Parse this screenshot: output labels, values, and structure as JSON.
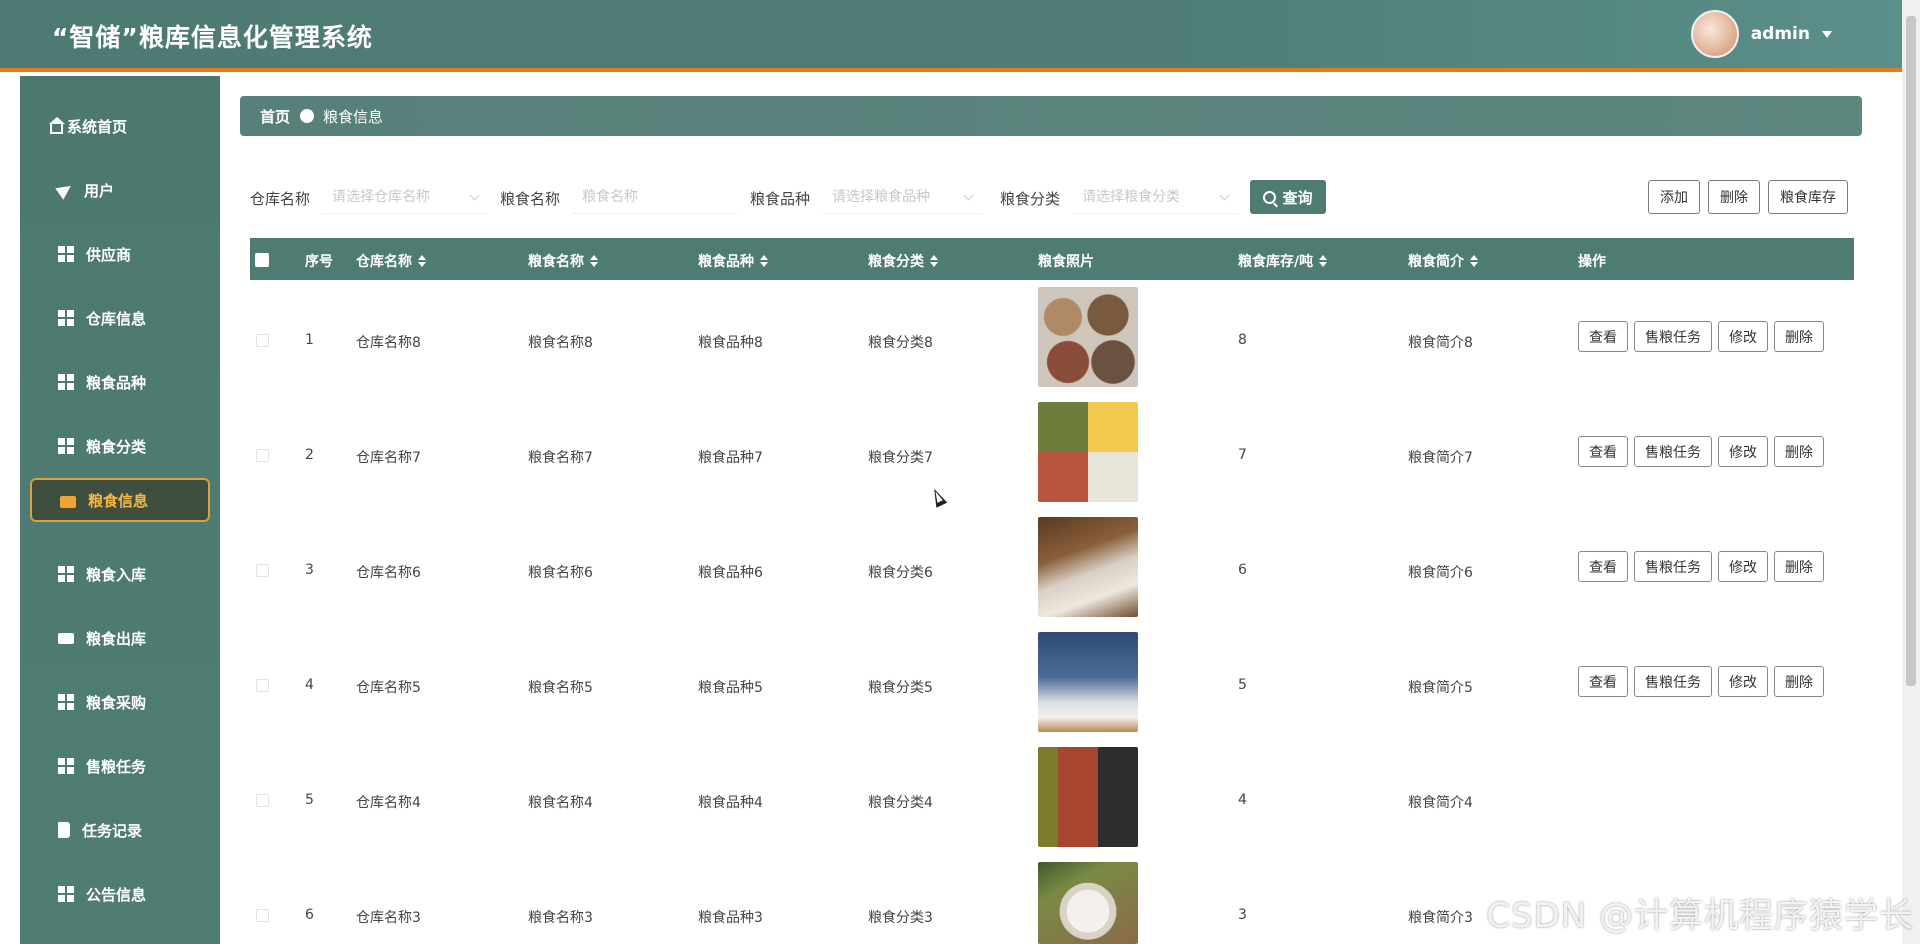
{
  "header": {
    "app_title": "“智储”粮库信息化管理系统",
    "user_name": "admin"
  },
  "sidebar": {
    "items": [
      {
        "label": "系统首页",
        "icon": "home-icon"
      },
      {
        "label": "用户",
        "icon": "send-icon"
      },
      {
        "label": "供应商",
        "icon": "grid-icon"
      },
      {
        "label": "仓库信息",
        "icon": "grid-icon"
      },
      {
        "label": "粮食品种",
        "icon": "grid-icon"
      },
      {
        "label": "粮食分类",
        "icon": "grid-icon"
      },
      {
        "label": "粮食信息",
        "icon": "briefcase-icon",
        "active": true
      },
      {
        "label": "粮食入库",
        "icon": "grid-icon"
      },
      {
        "label": "粮食出库",
        "icon": "ticket-icon"
      },
      {
        "label": "粮食采购",
        "icon": "grid-icon"
      },
      {
        "label": "售粮任务",
        "icon": "grid-icon"
      },
      {
        "label": "任务记录",
        "icon": "book-icon"
      },
      {
        "label": "公告信息",
        "icon": "grid-icon"
      }
    ],
    "active_color": "#f5b648"
  },
  "breadcrumb": {
    "home": "首页",
    "current": "粮食信息"
  },
  "filters": {
    "warehouse": {
      "label": "仓库名称",
      "placeholder": "请选择仓库名称"
    },
    "grain_name": {
      "label": "粮食名称",
      "placeholder": "粮食名称"
    },
    "grain_variety": {
      "label": "粮食品种",
      "placeholder": "请选择粮食品种"
    },
    "grain_category": {
      "label": "粮食分类",
      "placeholder": "请选择粮食分类"
    },
    "query_button": "查询"
  },
  "toolbar": {
    "add": "添加",
    "delete": "删除",
    "stock": "粮食库存"
  },
  "table": {
    "columns": [
      "序号",
      "仓库名称",
      "粮食名称",
      "粮食品种",
      "粮食分类",
      "粮食照片",
      "粮食库存/吨",
      "粮食简介",
      "操作"
    ],
    "rows": [
      {
        "index": "1",
        "warehouse": "仓库名称8",
        "name": "粮食名称8",
        "variety": "粮食品种8",
        "category": "粮食分类8",
        "stock": "8",
        "intro": "粮食简介8",
        "photo": "grain-sacks-photo"
      },
      {
        "index": "2",
        "warehouse": "仓库名称7",
        "name": "粮食名称7",
        "variety": "粮食品种7",
        "category": "粮食分类7",
        "stock": "7",
        "intro": "粮食简介7",
        "photo": "mixed-grains-bowl-photo"
      },
      {
        "index": "3",
        "warehouse": "仓库名称6",
        "name": "粮食名称6",
        "variety": "粮食品种6",
        "category": "粮食分类6",
        "stock": "6",
        "intro": "粮食简介6",
        "photo": "rice-spoon-photo"
      },
      {
        "index": "4",
        "warehouse": "仓库名称5",
        "name": "粮食名称5",
        "variety": "粮食品种5",
        "category": "粮食分类5",
        "stock": "5",
        "intro": "粮食简介5",
        "photo": "rice-pouring-photo"
      },
      {
        "index": "5",
        "warehouse": "仓库名称4",
        "name": "粮食名称4",
        "variety": "粮食品种4",
        "category": "粮食分类4",
        "stock": "4",
        "intro": "粮食简介4",
        "photo": "bean-stripes-photo"
      },
      {
        "index": "6",
        "warehouse": "仓库名称3",
        "name": "粮食名称3",
        "variety": "粮食品种3",
        "category": "粮食分类3",
        "stock": "3",
        "intro": "粮食简介3",
        "photo": "flour-bowl-photo"
      }
    ],
    "row_actions": {
      "view": "查看",
      "sell_task": "售粮任务",
      "edit": "修改",
      "delete": "删除"
    }
  },
  "watermark": "CSDN @计算机程序猿学长",
  "colors": {
    "theme": "#4e7c73",
    "header_border": "#ea7a18"
  }
}
